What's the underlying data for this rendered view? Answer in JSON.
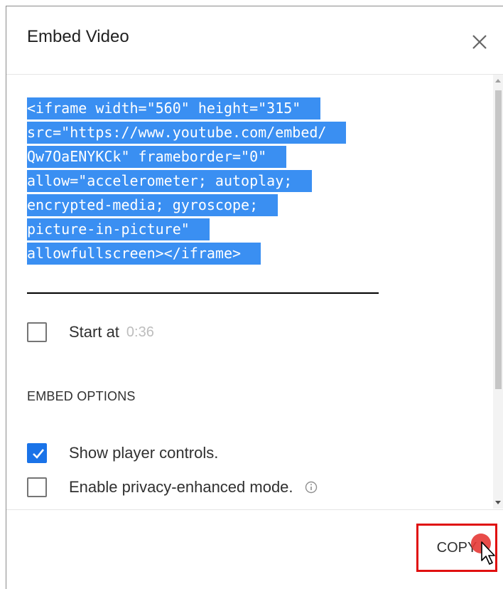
{
  "dialog": {
    "title": "Embed Video",
    "close_icon": "close-icon"
  },
  "embed_code": {
    "lines": [
      "<iframe width=\"560\" height=\"315\"",
      "src=\"https://www.youtube.com/embed/",
      "Qw7OaENYKCk\" frameborder=\"0\"",
      "allow=\"accelerometer; autoplay;",
      "encrypted-media; gyroscope;",
      "picture-in-picture\"",
      "allowfullscreen></iframe>"
    ],
    "selection_color": "#3a8ff2"
  },
  "start_at": {
    "label": "Start at",
    "time": "0:36",
    "checked": false
  },
  "embed_options": {
    "heading": "EMBED OPTIONS",
    "items": [
      {
        "label": "Show player controls.",
        "checked": true
      },
      {
        "label": "Enable privacy-enhanced mode.",
        "checked": false,
        "icon": "info-icon"
      }
    ]
  },
  "footer": {
    "copy_label": "COPY",
    "highlight_color": "#e01010"
  },
  "colors": {
    "accent": "#1a73e8",
    "click_indicator": "#e53935"
  }
}
